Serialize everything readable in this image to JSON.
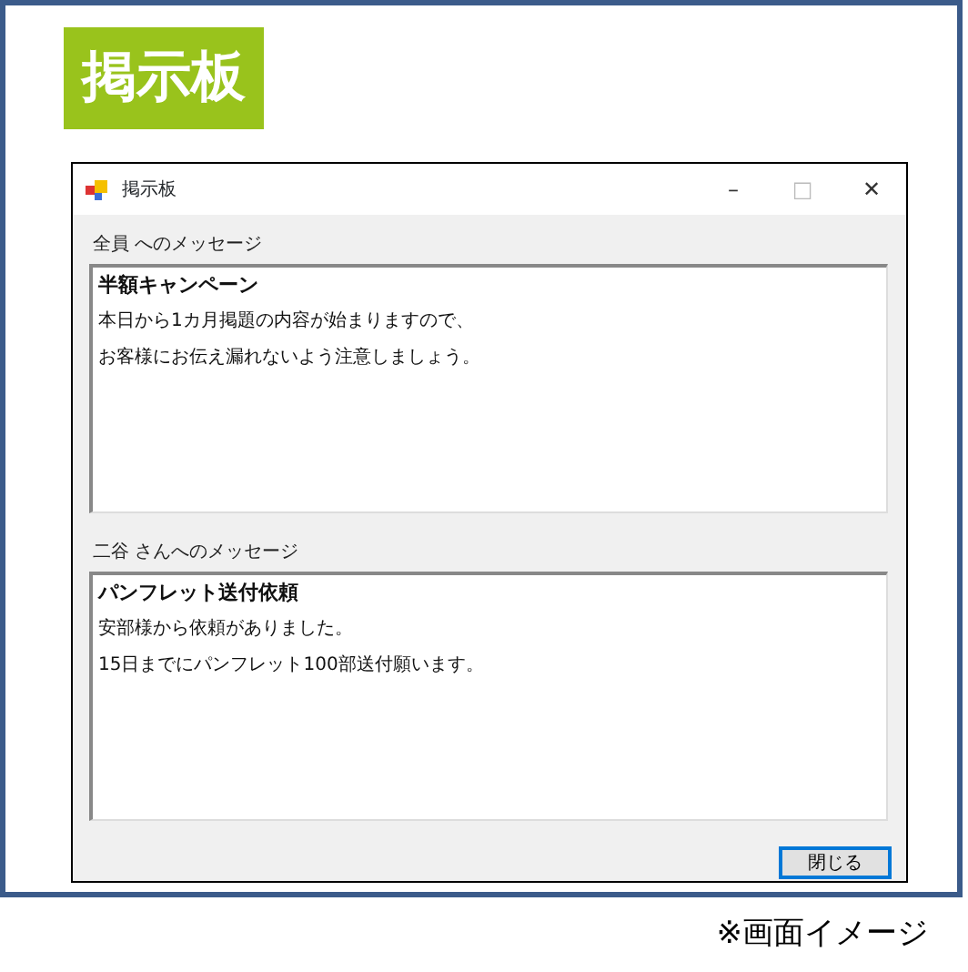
{
  "badge": "掲示板",
  "window": {
    "title": "掲示板",
    "controls": [
      "–",
      "□",
      "✕"
    ]
  },
  "messages": [
    {
      "label": "全員 へのメッセージ",
      "subject": "半額キャンペーン",
      "lines": [
        "本日から1カ月掲題の内容が始まりますので、",
        "お客様にお伝え漏れないよう注意しましょう。"
      ]
    },
    {
      "label": "二谷 さんへのメッセージ",
      "subject": "パンフレット送付依頼",
      "lines": [
        "安部様から依頼がありました。",
        "15日までにパンフレット100部送付願います。"
      ]
    }
  ],
  "buttons": [
    "閉じる"
  ],
  "caption": "※画面イメージ"
}
